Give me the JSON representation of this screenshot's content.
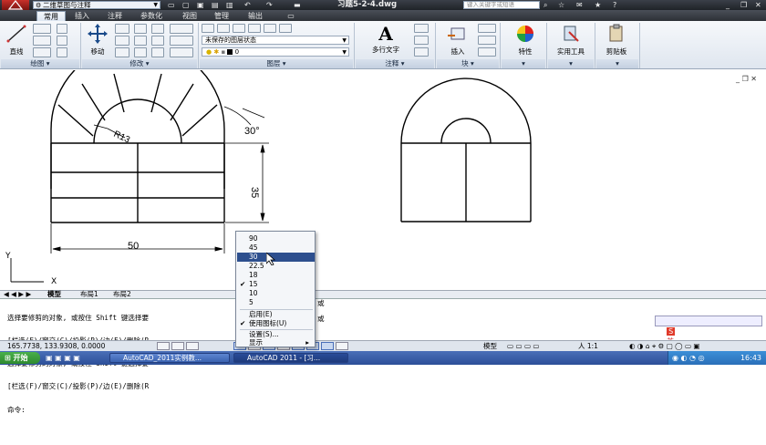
{
  "titlebar": {
    "workspace": "二维草图与注释",
    "title": "习题5-2-4.dwg",
    "search_placeholder": "键入关键字或短语"
  },
  "ribbon_tabs": [
    "常用",
    "插入",
    "注释",
    "参数化",
    "视图",
    "管理",
    "输出"
  ],
  "ribbon": {
    "draw": {
      "line_label": "直线",
      "panel_label": "绘图"
    },
    "modify": {
      "move_label": "移动",
      "panel_label": "修改"
    },
    "layers": {
      "layer_state": "未保存的图层状态",
      "layer_current": "0",
      "panel_label": "图层"
    },
    "annotation": {
      "mtext_label": "多行文字",
      "panel_label": "注释"
    },
    "block": {
      "insert_label": "插入",
      "panel_label": "块"
    },
    "properties_label": "特性",
    "utilities_label": "实用工具",
    "clipboard_label": "剪贴板"
  },
  "drawing": {
    "dim_radius": "R13",
    "dim_angle": "30°",
    "dim_height": "35",
    "dim_width": "50",
    "ucs_x": "X",
    "ucs_y": "Y"
  },
  "layout_tabs": [
    "模型",
    "布局1",
    "布局2"
  ],
  "command_lines": [
    "选择要修剪的对象, 或按住 Shift 键选择要",
    "[栏选(F)/窗交(C)/投影(P)/边(E)/删除(R",
    "选择要修剪的对象, 或按住 Shift 键选择要",
    "[栏选(F)/窗交(C)/投影(P)/边(E)/删除(R",
    "命令:"
  ],
  "command_tail": "或",
  "context_menu": {
    "angles": [
      "90",
      "45",
      "30",
      "22.5",
      "18",
      "15",
      "10",
      "5"
    ],
    "selected": "30",
    "checked": "15",
    "enable": "启用(E)",
    "use_icons": "使用图标(U)",
    "settings": "设置(S)...",
    "display": "显示"
  },
  "status": {
    "coords": "165.7738, 133.9308, 0.0000",
    "model": "模型",
    "scale": "人 1:1",
    "time": "16:43"
  },
  "ime": {
    "label": "英"
  },
  "taskbar": {
    "start": "开始",
    "tasks": [
      "AutoCAD_2011实例教...",
      "AutoCAD 2011 - [习..."
    ]
  }
}
